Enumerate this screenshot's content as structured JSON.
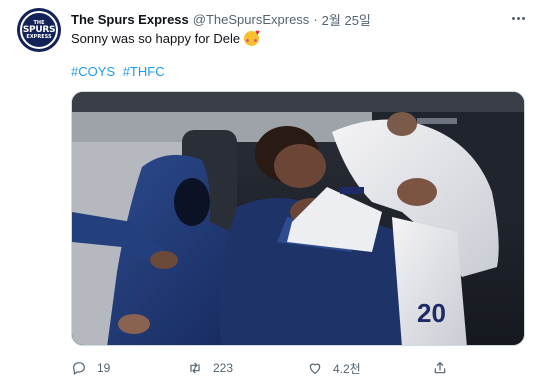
{
  "tweet": {
    "avatar": {
      "line1": "THE",
      "line2": "SPURS",
      "line3": "EXPRESS"
    },
    "author_name": "The Spurs Express",
    "handle": "@TheSpursExpress",
    "separator": "·",
    "date": "2월 25일",
    "text": "Sonny was so happy for Dele",
    "emoji": "smiling-face-with-hearts",
    "hashtags": [
      "#COYS",
      "#THFC"
    ],
    "media": {
      "shirt_number": "20"
    },
    "actions": {
      "reply_count": "19",
      "retweet_count": "223",
      "like_count": "4.2천"
    }
  },
  "colors": {
    "link": "#1d9bf0",
    "secondary_text": "#536471",
    "avatar_bg": "#132257"
  }
}
